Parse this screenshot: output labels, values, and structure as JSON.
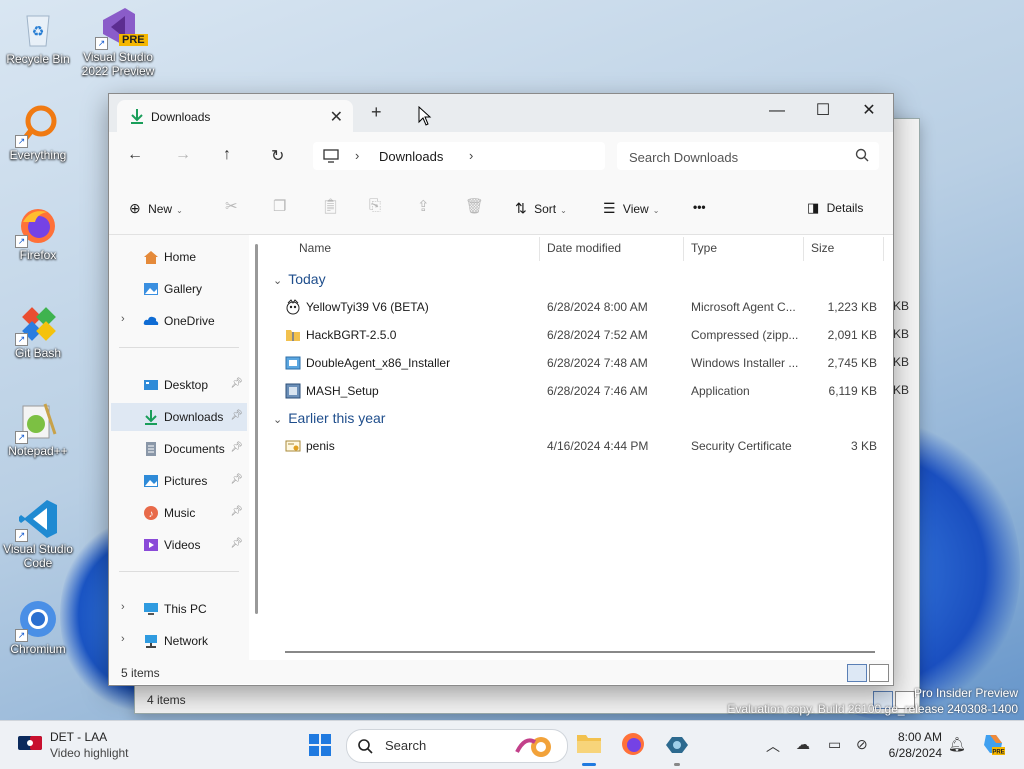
{
  "desktop": {
    "icons": [
      {
        "label": "Recycle Bin"
      },
      {
        "label": "Visual Studio 2022 Preview",
        "badge": "PRE"
      },
      {
        "label": "Everything"
      },
      {
        "label": "Firefox"
      },
      {
        "label": "Git Bash"
      },
      {
        "label": "Notepad++"
      },
      {
        "label": "Visual Studio Code"
      },
      {
        "label": "Chromium"
      }
    ],
    "watermark_line1": "Pro Insider Preview",
    "watermark_line2": "Evaluation copy. Build 26100.ge_release 240308-1400"
  },
  "back_window": {
    "status": "4 items",
    "sizes_suffix": [
      "KB",
      "KB",
      "KB",
      "KB"
    ]
  },
  "window": {
    "tab_title": "Downloads",
    "tab_close": "✕",
    "new_tab": "+",
    "controls": {
      "minimize": "—",
      "maximize": "☐",
      "close": "✕"
    },
    "address": {
      "location": "Downloads"
    },
    "search": {
      "placeholder": "Search Downloads"
    },
    "commands": {
      "new": "New",
      "sort": "Sort",
      "view": "View",
      "more": "•••",
      "details": "Details"
    },
    "sidebar": {
      "items": [
        {
          "label": "Home"
        },
        {
          "label": "Gallery"
        },
        {
          "label": "OneDrive"
        },
        {
          "label": "Desktop"
        },
        {
          "label": "Downloads"
        },
        {
          "label": "Documents"
        },
        {
          "label": "Pictures"
        },
        {
          "label": "Music"
        },
        {
          "label": "Videos"
        },
        {
          "label": "This PC"
        },
        {
          "label": "Network"
        }
      ]
    },
    "columns": {
      "name": "Name",
      "date": "Date modified",
      "type": "Type",
      "size": "Size"
    },
    "groups": [
      {
        "label": "Today"
      },
      {
        "label": "Earlier this year"
      }
    ],
    "files": [
      {
        "name": "YellowTyi39 V6 (BETA)",
        "date": "6/28/2024 8:00 AM",
        "type": "Microsoft Agent C...",
        "size": "1,223 KB"
      },
      {
        "name": "HackBGRT-2.5.0",
        "date": "6/28/2024 7:52 AM",
        "type": "Compressed (zipp...",
        "size": "2,091 KB"
      },
      {
        "name": "DoubleAgent_x86_Installer",
        "date": "6/28/2024 7:48 AM",
        "type": "Windows Installer ...",
        "size": "2,745 KB"
      },
      {
        "name": "MASH_Setup",
        "date": "6/28/2024 7:46 AM",
        "type": "Application",
        "size": "6,119 KB"
      },
      {
        "name": "penis",
        "date": "4/16/2024 4:44 PM",
        "type": "Security Certificate",
        "size": "3 KB"
      }
    ],
    "status": "5 items"
  },
  "taskbar": {
    "widget_title": "DET - LAA",
    "widget_sub": "Video highlight",
    "search_placeholder": "Search",
    "time": "8:00 AM",
    "date": "6/28/2024"
  }
}
